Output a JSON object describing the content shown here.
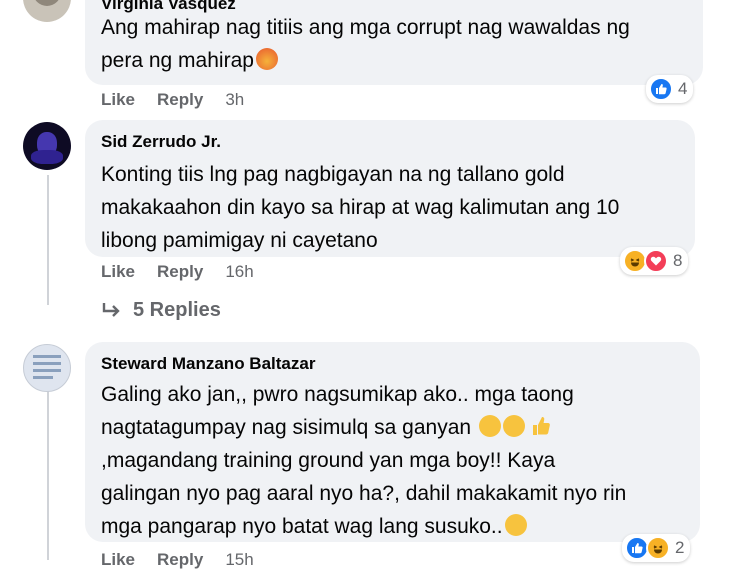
{
  "comments": [
    {
      "author": "Virginia Vasquez",
      "text_lines": [
        "Ang mahirap nag titiis ang mga corrupt nag wawaldas ng",
        "pera ng mahirap"
      ],
      "inline_emoji": [
        "angry-face"
      ],
      "actions": {
        "like": "Like",
        "reply": "Reply",
        "time": "3h"
      },
      "reactions": {
        "icons": [
          "like"
        ],
        "count": "4"
      }
    },
    {
      "author": "Sid Zerrudo Jr.",
      "text_lines": [
        "Konting tiis lng pag nagbigayan na ng tallano gold",
        "makakaahon din kayo sa hirap at wag kalimutan ang 10",
        "libong pamimigay ni cayetano"
      ],
      "actions": {
        "like": "Like",
        "reply": "Reply",
        "time": "16h"
      },
      "reactions": {
        "icons": [
          "haha",
          "love"
        ],
        "count": "8"
      },
      "replies_label": "5 Replies"
    },
    {
      "author": "Steward Manzano Baltazar",
      "text_lines": [
        "Galing ako jan,, pwro nagsumikap ako.. mga taong",
        "nagtatagumpay nag sisimulq sa ganyan",
        ",magandang training ground yan mga boy!! Kaya",
        "galingan nyo pag aaral nyo ha?, dahil makakamit nyo rin",
        "mga pangarap nyo batat wag lang susuko.."
      ],
      "inline_emoji": [
        "smiling-face",
        "smiling-face",
        "thumbs-up",
        "smiling-face"
      ],
      "actions": {
        "like": "Like",
        "reply": "Reply",
        "time": "15h"
      },
      "reactions": {
        "icons": [
          "like",
          "haha"
        ],
        "count": "2"
      }
    }
  ]
}
